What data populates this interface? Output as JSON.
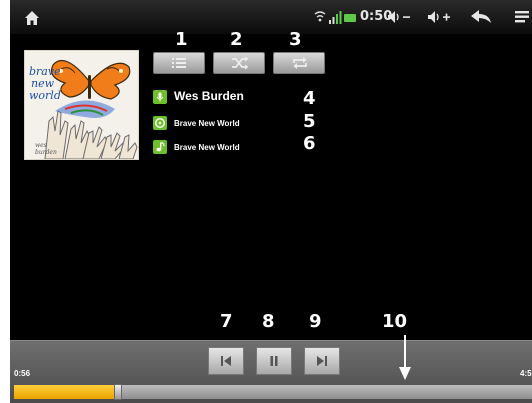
{
  "status_bar": {
    "time": "0:50",
    "icons": [
      "home-icon",
      "wifi-icon",
      "signal-icon",
      "battery-icon",
      "volume-down-icon",
      "volume-up-icon",
      "back-icon",
      "menu-icon"
    ]
  },
  "callouts": [
    "1",
    "2",
    "3",
    "4",
    "5",
    "6",
    "7",
    "8",
    "9",
    "10"
  ],
  "controls": {
    "playlist_icon": "playlist-icon",
    "shuffle_icon": "shuffle-icon",
    "repeat_icon": "repeat-icon"
  },
  "track": {
    "artist": "Wes Burden",
    "album": "Brave New World",
    "song": "Brave New World"
  },
  "album_art": {
    "title_lines": [
      "brave",
      "new",
      "world"
    ],
    "signature_lines": [
      "wes",
      "burden"
    ]
  },
  "player": {
    "time_elapsed": "0:56",
    "time_total": "4:5",
    "progress_fraction": 0.2
  },
  "colors": {
    "accent_green": "#6fbf2a",
    "progress_yellow": "#f2b51a",
    "battery_green": "#5ec94a"
  }
}
